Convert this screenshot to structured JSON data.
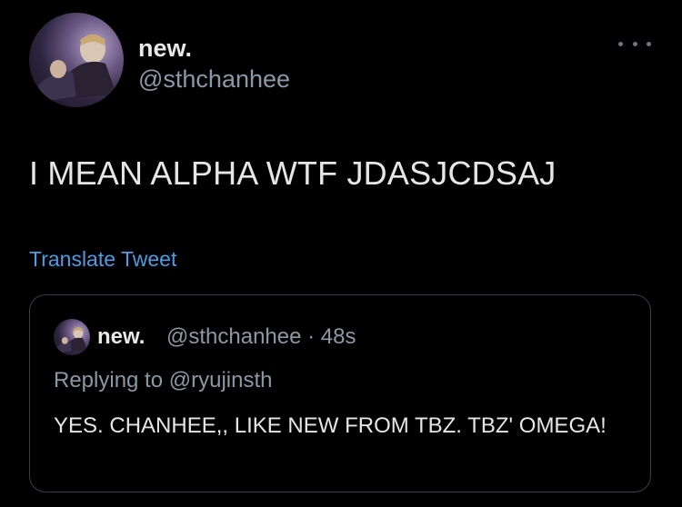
{
  "tweet": {
    "author_name": "new.",
    "author_handle": "@sthchanhee",
    "text": "I MEAN ALPHA WTF JDASJCDSAJ",
    "translate_label": "Translate Tweet",
    "more_icon": "more-horizontal-icon"
  },
  "quoted_tweet": {
    "author_name": "new.",
    "author_handle_time": "@sthchanhee · 48s",
    "replying_to": "Replying to @ryujinsth",
    "text": "YES. CHANHEE,, LIKE NEW FROM TBZ. TBZ' OMEGA!"
  },
  "colors": {
    "background": "#000000",
    "link": "#4a9de6",
    "secondary_text": "#8b98a5",
    "border": "#3a3f44"
  }
}
